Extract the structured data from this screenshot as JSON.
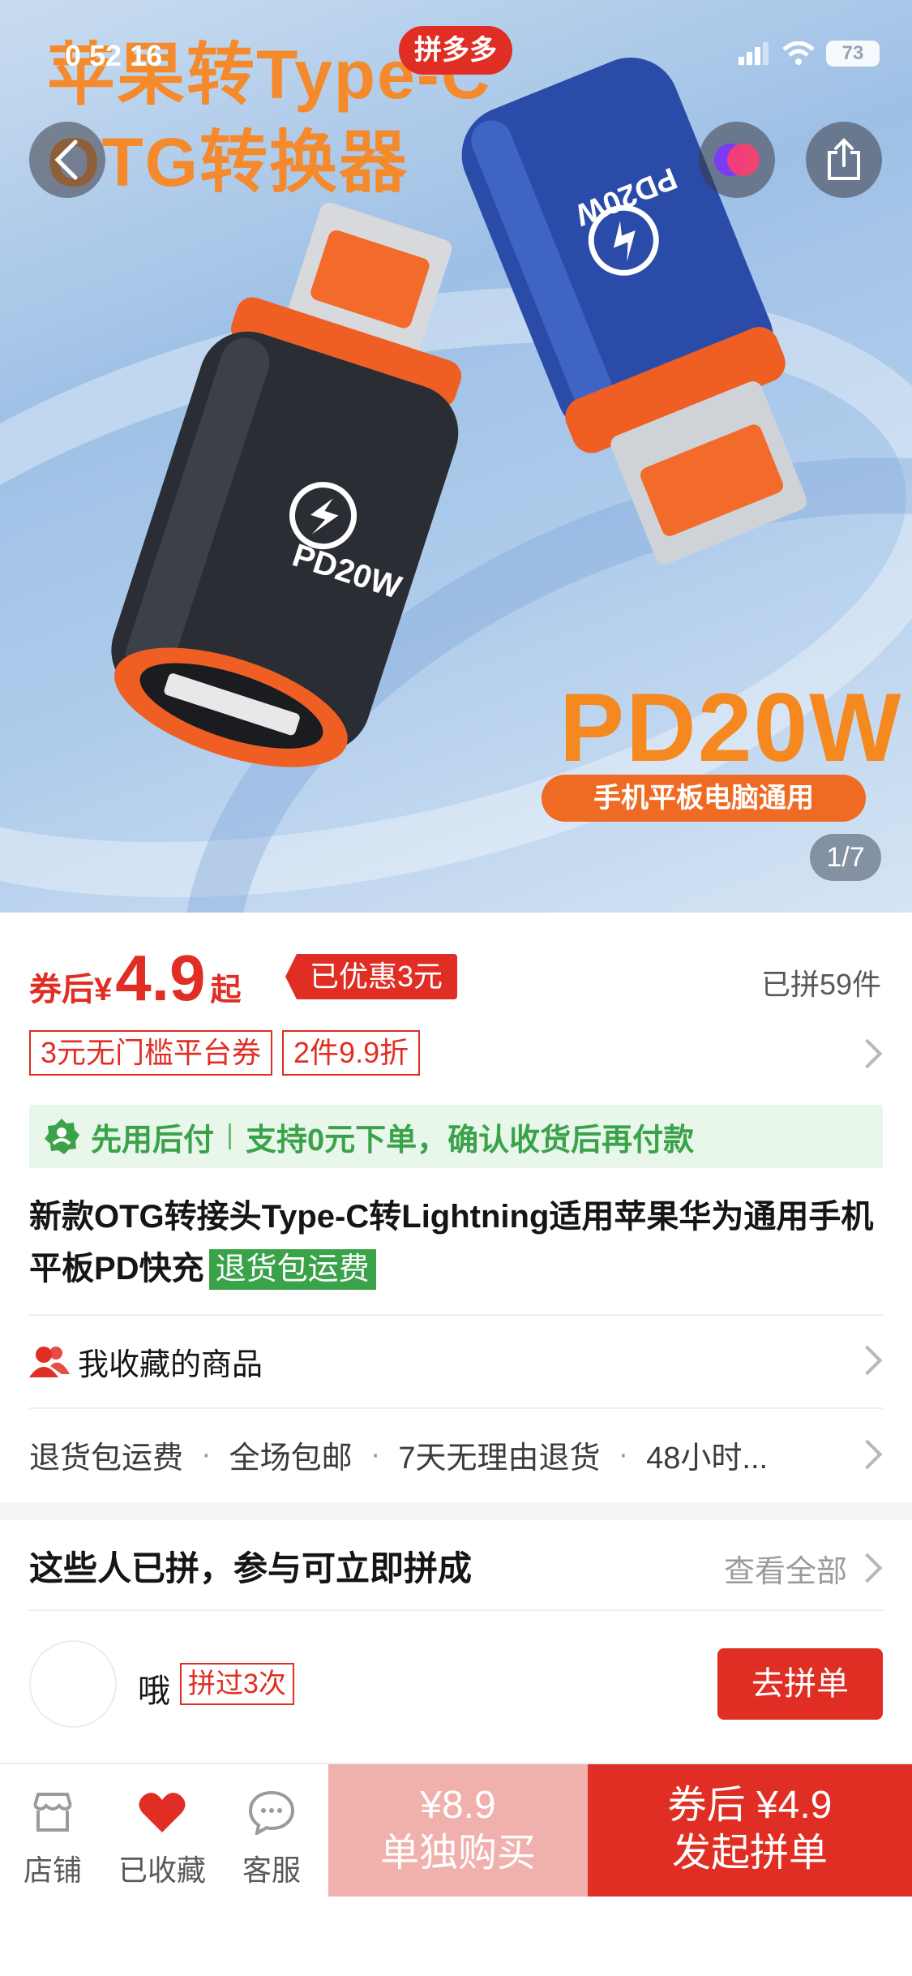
{
  "status": {
    "time": "0 52 16",
    "app_badge": "拼多多",
    "battery": "73"
  },
  "hero": {
    "title_line1": "苹果转Type-C",
    "title_line2": "OTG转换器",
    "adapter_label_1": "PD20W",
    "adapter_label_2": "PD20W",
    "big_label": "PD20W",
    "pill": "手机平板电脑通用",
    "counter": "1/7"
  },
  "price": {
    "prefix": "券后",
    "yen": "¥",
    "value": "4.9",
    "suffix": "起",
    "discount_tag": "已优惠3元",
    "sold": "已拼59件"
  },
  "coupons": [
    "3元无门槛平台券",
    "2件9.9折"
  ],
  "paylater": {
    "label": "先用后付",
    "desc": "支持0元下单，确认收货后再付款"
  },
  "product": {
    "title": "新款OTG转接头Type-C转Lightning适用苹果华为通用手机平板PD快充",
    "tag": "退货包运费"
  },
  "favorites_row": {
    "label": "我收藏的商品"
  },
  "services": [
    "退货包运费",
    "全场包邮",
    "7天无理由退货",
    "48小时..."
  ],
  "group": {
    "heading": "这些人已拼，参与可立即拼成",
    "view_all": "查看全部",
    "member_name": "哦",
    "member_badge": "拼过3次",
    "join_button": "去拼单"
  },
  "bottom_bar": {
    "store": "店铺",
    "favorited": "已收藏",
    "service": "客服",
    "solo_price": "¥8.9",
    "solo_label": "单独购买",
    "group_price": "券后 ¥4.9",
    "group_label": "发起拼单"
  },
  "colors": {
    "accent": "#e02e24",
    "green": "#3aa34a",
    "light_red": "#f0b1ad"
  }
}
